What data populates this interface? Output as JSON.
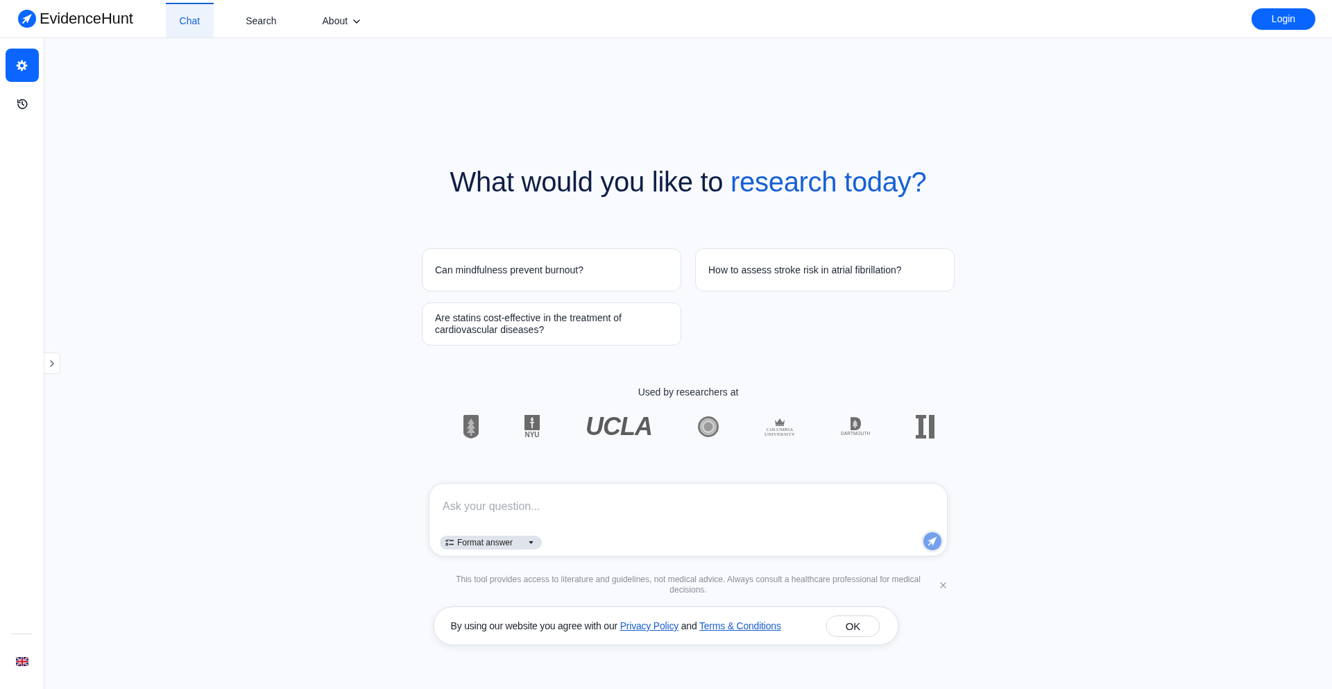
{
  "header": {
    "brand": "EvidenceHunt",
    "tabs": [
      {
        "label": "Chat",
        "selected": true,
        "kind": "link"
      },
      {
        "label": "Search",
        "selected": false,
        "kind": "link"
      },
      {
        "label": "About",
        "selected": false,
        "kind": "dropdown"
      }
    ],
    "login": "Login"
  },
  "sidebar": {
    "items": [
      {
        "kind": "settings",
        "selected": true
      },
      {
        "kind": "history",
        "selected": false
      }
    ]
  },
  "hero": {
    "heading": "What would you like to",
    "highlight": "research today?"
  },
  "suggestions": [
    "Can mindfulness prevent burnout?",
    "How to assess stroke risk in atrial fibrillation?",
    "Are statins cost-effective in the treatment of cardiovascular diseases?"
  ],
  "partners": {
    "caption": "Used by researchers at",
    "logos": [
      {
        "kind": "shield"
      },
      {
        "kind": "torch",
        "text": "NYU"
      },
      {
        "kind": "wordmark",
        "text": "UCLA"
      },
      {
        "kind": "seal"
      },
      {
        "kind": "crown",
        "text": "COLUMBIA UNIVERSITY"
      },
      {
        "kind": "crest",
        "text": "DARTMOUTH"
      },
      {
        "kind": "block"
      }
    ]
  },
  "composer": {
    "placeholder": "Ask your question...",
    "format_label": "Format answer",
    "send_disabled": true
  },
  "disclaimer": "This tool provides access to literature and guidelines, not medical advice. Always consult a healthcare professional for medical decisions.",
  "cookie_banner": {
    "message": [
      {
        "kind": "text",
        "text": "By using our website you agree with our"
      },
      {
        "kind": "link",
        "text": "Privacy Policy"
      },
      {
        "kind": "text",
        "text": "and"
      },
      {
        "kind": "link",
        "text": "Terms & Conditions"
      }
    ],
    "ok": "OK"
  }
}
